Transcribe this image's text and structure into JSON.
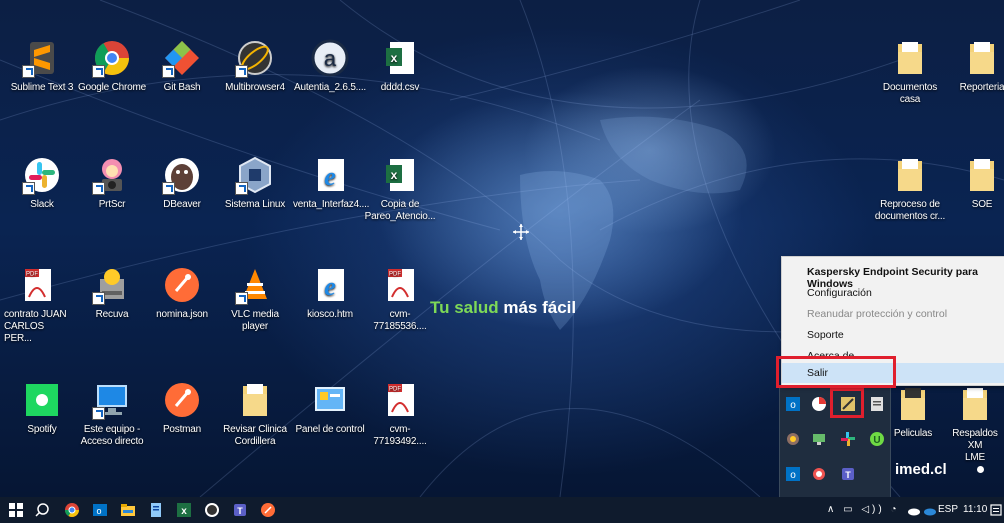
{
  "desktop": {
    "icons": [
      {
        "label": "Sublime Text 3",
        "icon": "sublime-icon"
      },
      {
        "label": "Google Chrome",
        "icon": "chrome-icon"
      },
      {
        "label": "Git Bash",
        "icon": "git-bash-icon"
      },
      {
        "label": "Multibrowser4",
        "icon": "multibrowser-icon"
      },
      {
        "label": "Autentia_2.6.5....",
        "icon": "autentia-icon"
      },
      {
        "label": "dddd.csv",
        "icon": "excel-csv-icon"
      },
      {
        "label": "Slack",
        "icon": "slack-icon"
      },
      {
        "label": "PrtScr",
        "icon": "prtscr-icon"
      },
      {
        "label": "DBeaver",
        "icon": "dbeaver-icon"
      },
      {
        "label": "Sistema Linux",
        "icon": "virtualbox-icon"
      },
      {
        "label": "venta_Interfaz4....",
        "icon": "ie-html-icon"
      },
      {
        "label": "Copia de\nPareo_Atencio...",
        "icon": "excel-icon"
      },
      {
        "label": "contrato JUAN\nCARLOS PER...",
        "icon": "pdf-icon"
      },
      {
        "label": "Recuva",
        "icon": "recuva-icon"
      },
      {
        "label": "nomina.json",
        "icon": "postman-icon"
      },
      {
        "label": "VLC media player",
        "icon": "vlc-icon"
      },
      {
        "label": "kiosco.htm",
        "icon": "ie-html-icon"
      },
      {
        "label": "cvm-77185536....",
        "icon": "pdf-icon"
      },
      {
        "label": "Spotify",
        "icon": "spotify-icon"
      },
      {
        "label": "Este equipo -\nAcceso directo",
        "icon": "computer-icon"
      },
      {
        "label": "Postman",
        "icon": "postman-icon"
      },
      {
        "label": "Revisar Clinica\nCordillera",
        "icon": "folder-icon"
      },
      {
        "label": "Panel de control",
        "icon": "control-panel-icon"
      },
      {
        "label": "cvm-77193492....",
        "icon": "pdf-icon"
      },
      {
        "label": "Documentos\ncasa",
        "icon": "folder-icon"
      },
      {
        "label": "Reporteria",
        "icon": "folder-icon"
      },
      {
        "label": "Reproceso de\ndocumentos cr...",
        "icon": "folder-icon"
      },
      {
        "label": "SOE",
        "icon": "folder-icon"
      },
      {
        "label": "Peliculas",
        "icon": "folder-icon"
      },
      {
        "label": "Respaldos XM\nLME",
        "icon": "folder-icon"
      }
    ],
    "slogan_part1": "Tu salud",
    "slogan_part2": " más fácil",
    "brand": "imed.cl"
  },
  "context_menu": {
    "title": "Kaspersky Endpoint Security para Windows",
    "items": [
      "Configuración",
      "Reanudar protección y control",
      "Soporte",
      "Acerca de",
      "Salir"
    ]
  },
  "taskbar": {
    "language": "ESP",
    "time": "11:10",
    "tray_symbols": "∧ ▭ ◁)) ◔",
    "pinned": [
      "windows-start-icon",
      "search-icon",
      "chrome-icon",
      "outlook-icon",
      "file-explorer-icon",
      "notes-icon",
      "excel-icon",
      "github-icon",
      "teams-icon",
      "postman-icon"
    ]
  },
  "colors": {
    "accent_green": "#7ed957",
    "highlight_red": "#e01f2d",
    "menu_selected": "#cde3f7"
  }
}
